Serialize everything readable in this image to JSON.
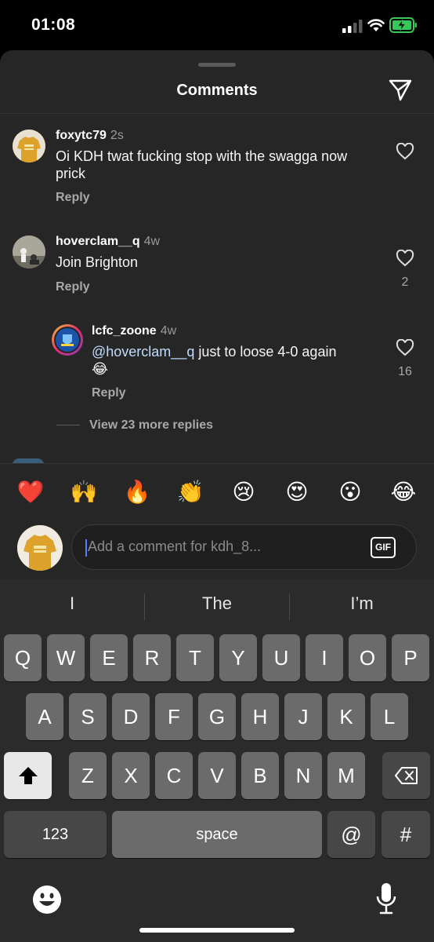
{
  "status": {
    "time": "01:08"
  },
  "header": {
    "title": "Comments"
  },
  "comments": [
    {
      "user": "foxytc79",
      "time": "2s",
      "text_l1": "Oi KDH twat fucking stop with the swagga now",
      "text_l2": "prick",
      "reply": "Reply"
    },
    {
      "user": "hoverclam__q",
      "time": "4w",
      "text": "Join Brighton",
      "reply": "Reply",
      "likes": "2"
    },
    {
      "user": "lcfc_zoone",
      "time": "4w",
      "mention": "@hoverclam__q",
      "text_l1": " just to loose 4-0 again",
      "emoji": "😂",
      "reply": "Reply",
      "likes": "16"
    }
  ],
  "view_more": "View 23 more replies",
  "emoji_bar": [
    "❤️",
    "🙌",
    "🔥",
    "👏",
    "😢",
    "😍",
    "😮",
    "😂"
  ],
  "input": {
    "placeholder": "Add a comment for kdh_8...",
    "gif_label": "GIF"
  },
  "keyboard": {
    "suggestions": [
      "I",
      "The",
      "I’m"
    ],
    "row1": [
      "Q",
      "W",
      "E",
      "R",
      "T",
      "Y",
      "U",
      "I",
      "O",
      "P"
    ],
    "row2": [
      "A",
      "S",
      "D",
      "F",
      "G",
      "H",
      "J",
      "K",
      "L"
    ],
    "row3": [
      "Z",
      "X",
      "C",
      "V",
      "B",
      "N",
      "M"
    ],
    "numbers": "123",
    "space": "space",
    "at": "@",
    "hash": "#"
  },
  "colors": {
    "sheet_bg": "#262626",
    "mention": "#c0dcff",
    "caret": "#5b7cff"
  }
}
